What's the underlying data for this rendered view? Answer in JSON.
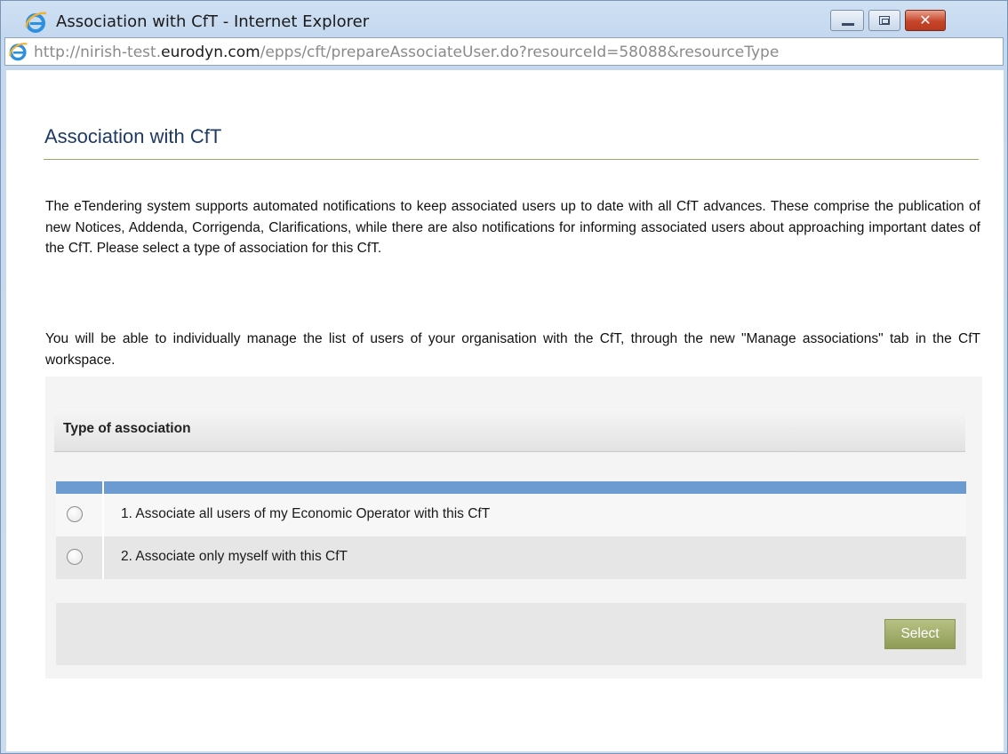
{
  "window": {
    "title": "Association with CfT - Internet Explorer",
    "close_glyph": "✕",
    "icons": {
      "browser": "internet-explorer-icon",
      "minimize": "minimize-icon",
      "maximize": "maximize-icon",
      "close": "close-icon"
    }
  },
  "address_bar": {
    "prefix": "http://nirish-test.",
    "domain": "eurodyn.com",
    "suffix": "/epps/cft/prepareAssociateUser.do?resourceId=58088&resourceType"
  },
  "page": {
    "title": "Association with CfT",
    "paragraph1": "The eTendering system supports automated notifications to keep associated users up to date with all CfT advances. These comprise the publication of new Notices, Addenda, Corrigenda, Clarifications, while there are also notifications for informing associated users about approaching important dates of the CfT. Please select a type of association for this CfT.",
    "paragraph2": "You will be able to individually manage the list of users of your organisation with the CfT, through the new \"Manage associations\" tab in the CfT workspace."
  },
  "association": {
    "header": "Type of association",
    "options": [
      {
        "label": "1. Associate all users of my Economic Operator with this CfT",
        "selected": false
      },
      {
        "label": "2. Associate only myself with this CfT",
        "selected": false
      }
    ],
    "select_button": "Select"
  },
  "colors": {
    "table_header": "#6b9bd0",
    "select_button": "#9aa65e",
    "title_text": "#1e3a66",
    "title_rule": "#9aa86a"
  }
}
